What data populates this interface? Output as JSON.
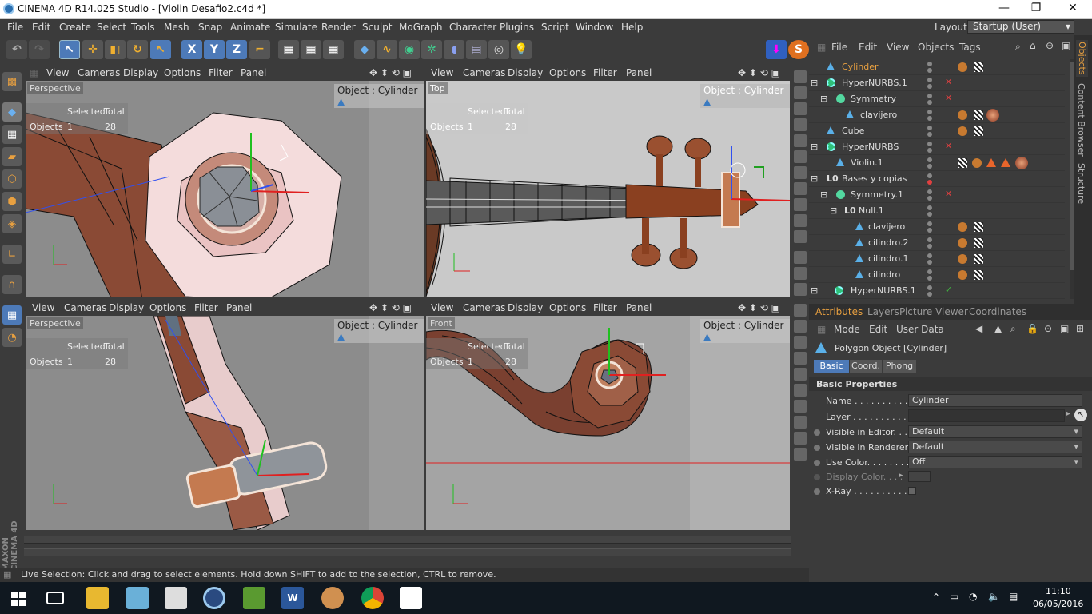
{
  "window": {
    "title": "CINEMA 4D R14.025 Studio - [Violin Desafio2.c4d *]",
    "min": "—",
    "max": "❐",
    "close": "✕"
  },
  "menu": [
    "File",
    "Edit",
    "Create",
    "Select",
    "Tools",
    "Mesh",
    "Snap",
    "Animate",
    "Simulate",
    "Render",
    "Sculpt",
    "MoGraph",
    "Character",
    "Plugins",
    "Script",
    "Window",
    "Help"
  ],
  "layout": {
    "label": "Layout:",
    "value": "Startup (User)"
  },
  "viewport_menu": [
    "View",
    "Cameras",
    "Display",
    "Options",
    "Filter",
    "Panel"
  ],
  "viewports": [
    {
      "name": "Perspective",
      "object": "Object : Cylinder"
    },
    {
      "name": "Top",
      "object": "Object : Cylinder"
    },
    {
      "name": "Perspective",
      "object": "Object : Cylinder"
    },
    {
      "name": "Front",
      "object": "Object : Cylinder"
    }
  ],
  "stats": {
    "selected": "Selected",
    "total": "Total",
    "objects": "Objects",
    "sel_count": "1",
    "total_count": "28"
  },
  "axis": {
    "x": "X",
    "y": "Y",
    "z": "Z"
  },
  "status": "Live Selection: Click and drag to select elements. Hold down SHIFT to add to the selection, CTRL to remove.",
  "branding": "MAXON CINEMA 4D",
  "object_manager": {
    "menu": [
      "File",
      "Edit",
      "View",
      "Objects",
      "Tags"
    ],
    "rows": [
      {
        "name": "Cylinder",
        "icon": "triangle",
        "indent": 0
      },
      {
        "name": "HyperNURBS.1",
        "icon": "hypernurbs",
        "indent": 0
      },
      {
        "name": "Symmetry",
        "icon": "symmetry",
        "indent": 1
      },
      {
        "name": "clavijero",
        "icon": "triangle",
        "indent": 2
      },
      {
        "name": "Cube",
        "icon": "triangle",
        "indent": 0
      },
      {
        "name": "HyperNURBS",
        "icon": "hypernurbs",
        "indent": 0
      },
      {
        "name": "Violin.1",
        "icon": "triangle",
        "indent": 1
      },
      {
        "name": "Bases y copias",
        "icon": "null",
        "indent": 0
      },
      {
        "name": "Symmetry.1",
        "icon": "symmetry",
        "indent": 1
      },
      {
        "name": "Null.1",
        "icon": "null",
        "indent": 2
      },
      {
        "name": "clavijero",
        "icon": "triangle",
        "indent": 3
      },
      {
        "name": "cilindro.2",
        "icon": "triangle",
        "indent": 3
      },
      {
        "name": "cilindro.1",
        "icon": "triangle",
        "indent": 3
      },
      {
        "name": "cilindro",
        "icon": "triangle",
        "indent": 3
      },
      {
        "name": "HyperNURBS.1",
        "icon": "hypernurbs",
        "indent": 0
      }
    ]
  },
  "side_tabs": [
    "Objects",
    "Content Browser",
    "Structure"
  ],
  "attr_tabs": [
    "Attributes",
    "Layers",
    "Picture Viewer",
    "Coordinates"
  ],
  "attr_menu": [
    "Mode",
    "Edit",
    "User Data"
  ],
  "attr": {
    "object_type": "Polygon Object [Cylinder]",
    "sub_tabs": [
      "Basic",
      "Coord.",
      "Phong"
    ],
    "section": "Basic Properties",
    "props": [
      {
        "label": "Name . . . . . . . . . . .",
        "value": "Cylinder"
      },
      {
        "label": "Layer . . . . . . . . . . .",
        "value": ""
      },
      {
        "label": "Visible in Editor. . .",
        "value": "Default"
      },
      {
        "label": "Visible in Renderer",
        "value": "Default"
      },
      {
        "label": "Use Color. . . . . . . .",
        "value": "Off"
      },
      {
        "label": "Display Color. . . .",
        "value": ""
      },
      {
        "label": "X-Ray . . . . . . . . . .",
        "value": ""
      }
    ]
  },
  "clock": {
    "time": "11:10",
    "date": "06/05/2016"
  },
  "colors": {
    "accent": "#e8a040",
    "selected_row": "#e8a040",
    "bg": "#3b3b3b"
  }
}
